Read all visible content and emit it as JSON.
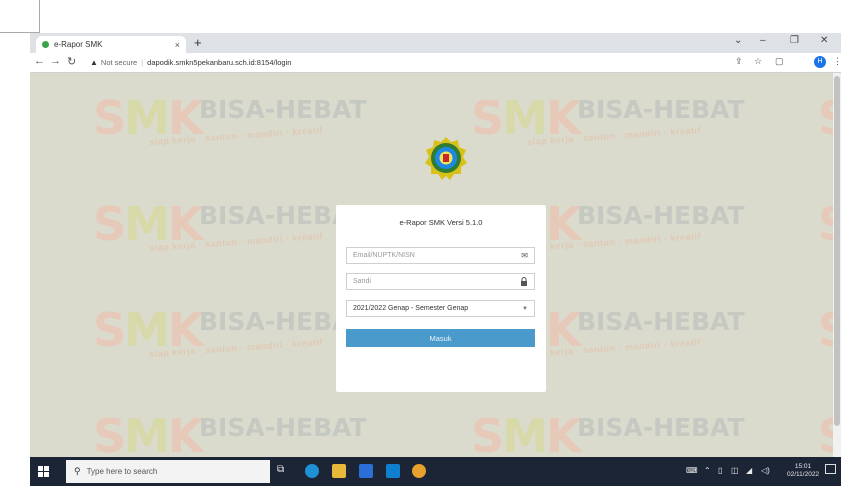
{
  "browser": {
    "tab_title": "e-Rapor SMK",
    "tab_close": "×",
    "new_tab": "+",
    "security_label": "Not secure",
    "url": "dapodik.smkn5pekanbaru.sch.id:8154/login",
    "profile_initial": "H"
  },
  "watermark": {
    "brand_s": "S",
    "brand_m": "M",
    "brand_k": "K",
    "headline": "BISA-HEBAT",
    "tagline": "siap kerja · santun · mandiri · kreatif"
  },
  "login": {
    "title": "e-Rapor SMK Versi 5.1.0",
    "email_placeholder": "Email/NUPTK/NISN",
    "password_placeholder": "Sandi",
    "semester_value": "2021/2022 Genap - Semester Genap",
    "submit_label": "Masuk"
  },
  "taskbar": {
    "search_placeholder": "Type here to search",
    "time": "15:01",
    "date": "02/11/2022"
  },
  "colors": {
    "page_bg": "#dadbcd",
    "button": "#4a9acb",
    "taskbar": "#1c2536"
  }
}
